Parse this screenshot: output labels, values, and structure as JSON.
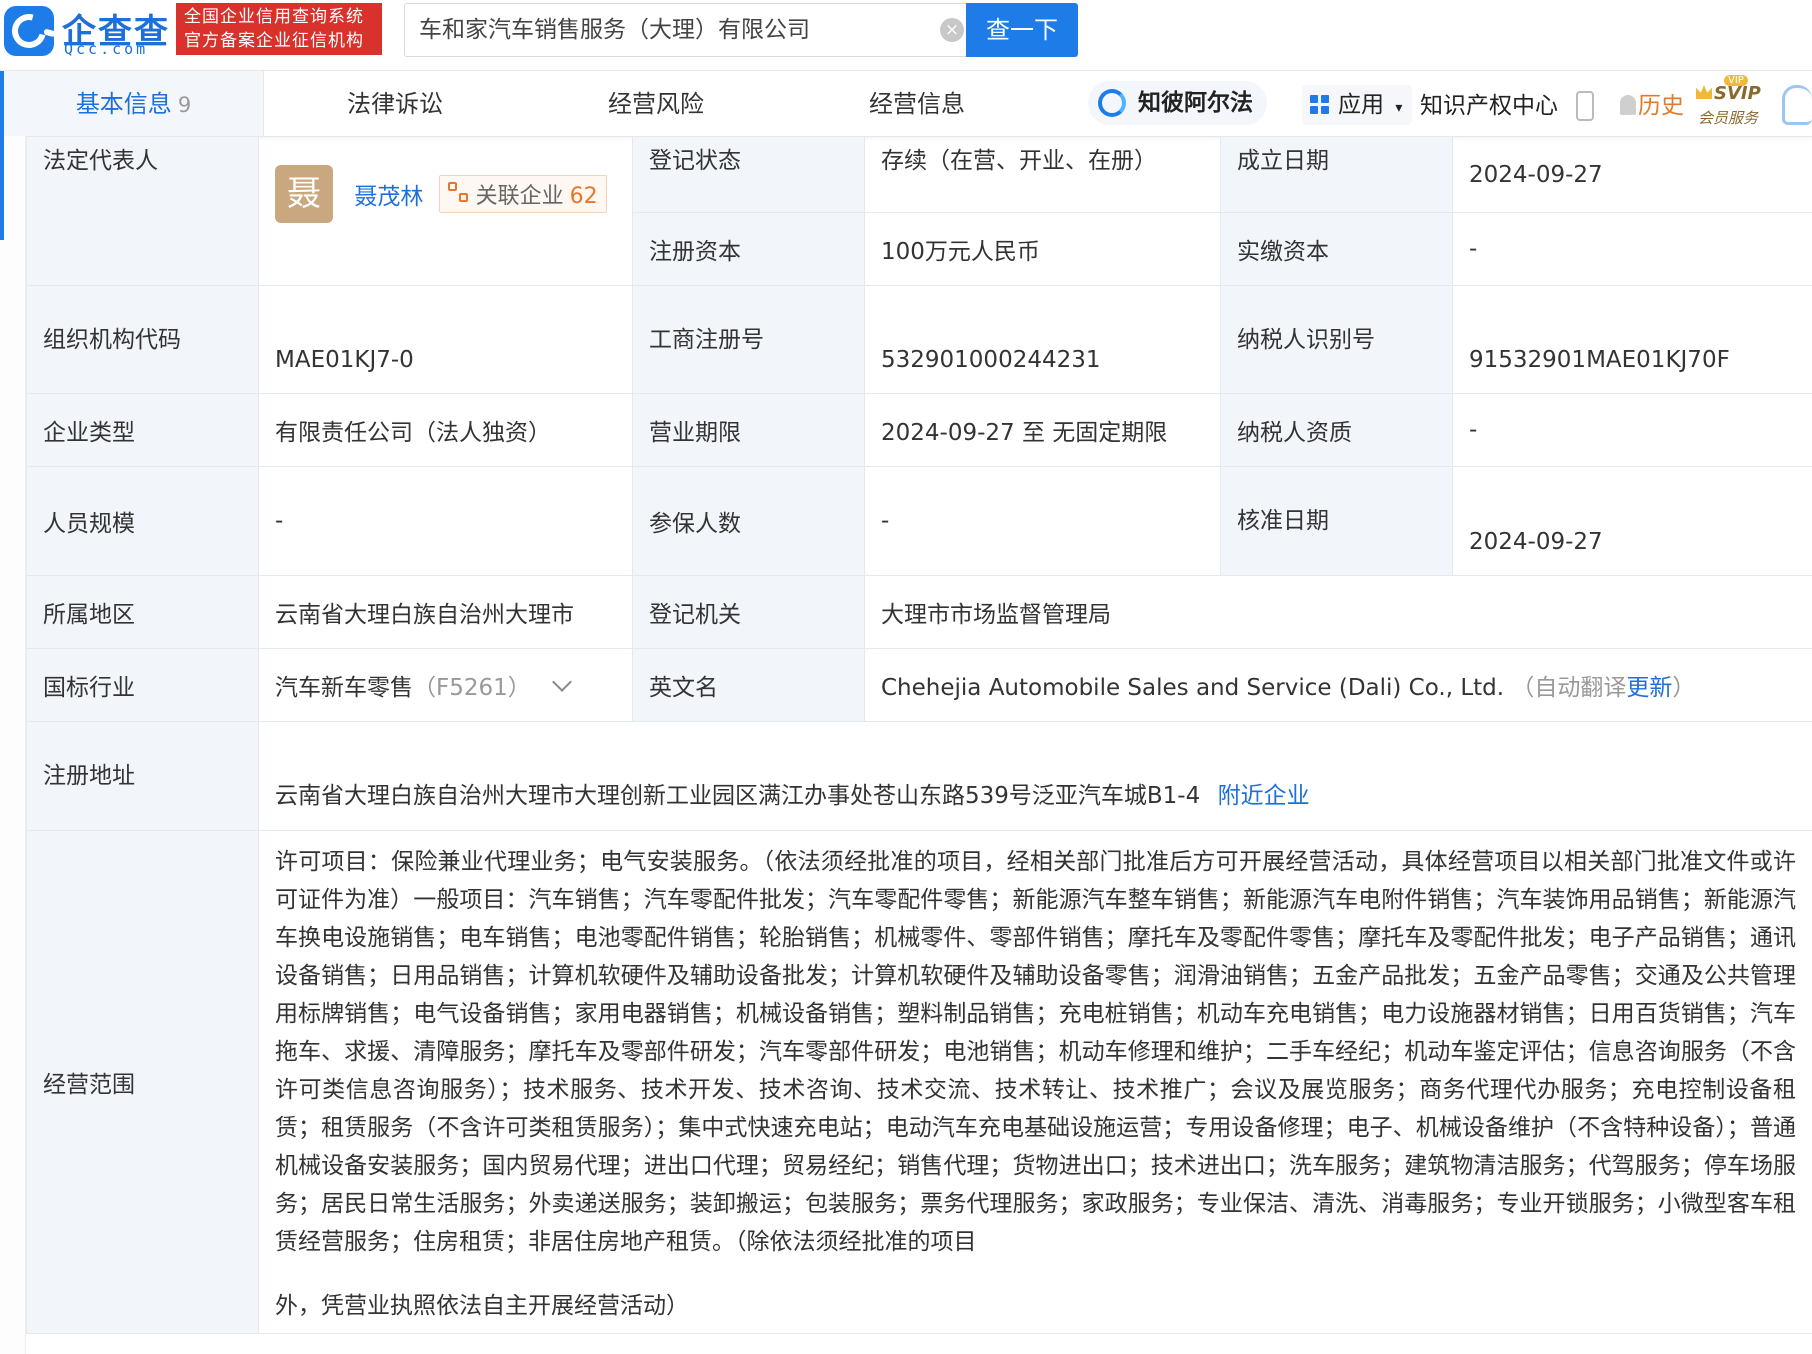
{
  "header": {
    "logo_text": "企查查",
    "logo_sub": "Qcc.com",
    "slogan_line1": "全国企业信用查询系统",
    "slogan_line2": "官方备案企业征信机构",
    "search_value": "车和家汽车销售服务（大理）有限公司",
    "search_button": "查一下"
  },
  "nav": {
    "tabs": [
      {
        "label": "基本信息",
        "count": "9"
      },
      {
        "label": "法律诉讼"
      },
      {
        "label": "经营风险"
      },
      {
        "label": "经营信息"
      }
    ],
    "zhibi": "知彼阿尔法",
    "apps": "应用",
    "zhichan": "知识产权中心",
    "history": "历史",
    "svip_l1": "SVIP",
    "svip_l2": "会员服务",
    "vip_tag": "VIP"
  },
  "info": {
    "legal_rep": {
      "label": "法定代表人",
      "avatar_char": "聂",
      "name": "聂茂林",
      "related_label": "关联企业",
      "related_count": "62"
    },
    "reg_status": {
      "label": "登记状态",
      "value": "存续（在营、开业、在册）"
    },
    "found_date": {
      "label": "成立日期",
      "value": "2024-09-27"
    },
    "reg_capital": {
      "label": "注册资本",
      "value": "100万元人民币"
    },
    "paid_capital": {
      "label": "实缴资本",
      "value": "-"
    },
    "org_code": {
      "label": "组织机构代码",
      "value": "MAE01KJ7-0"
    },
    "biz_reg_no": {
      "label": "工商注册号",
      "value": "532901000244231"
    },
    "taxpayer_id": {
      "label": "纳税人识别号",
      "value": "91532901MAE01KJ70F"
    },
    "company_type": {
      "label": "企业类型",
      "value": "有限责任公司（法人独资）"
    },
    "biz_term": {
      "label": "营业期限",
      "value": "2024-09-27 至 无固定期限"
    },
    "taxpayer_qual": {
      "label": "纳税人资质",
      "value": "-"
    },
    "staff_size": {
      "label": "人员规模",
      "value": "-"
    },
    "insured": {
      "label": "参保人数",
      "value": "-"
    },
    "approve_date": {
      "label": "核准日期",
      "value": "2024-09-27"
    },
    "region": {
      "label": "所属地区",
      "value": "云南省大理白族自治州大理市"
    },
    "reg_authority": {
      "label": "登记机关",
      "value": "大理市市场监督管理局"
    },
    "industry": {
      "label": "国标行业",
      "value": "汽车新车零售",
      "code": "（F5261）"
    },
    "english_name": {
      "label": "英文名",
      "value": "Chehejia Automobile Sales and Service (Dali) Co., Ltd.",
      "note_prefix": "（自动翻译",
      "note_link": "更新",
      "note_suffix": "）"
    },
    "reg_address": {
      "label": "注册地址",
      "value": "云南省大理白族自治州大理市大理创新工业园区满江办事处苍山东路539号泛亚汽车城B1-4",
      "nearby": "附近企业"
    },
    "scope": {
      "label": "经营范围",
      "value": "许可项目：保险兼业代理业务；电气安装服务。（依法须经批准的项目，经相关部门批准后方可开展经营活动，具体经营项目以相关部门批准文件或许可证件为准）一般项目：汽车销售；汽车零配件批发；汽车零配件零售；新能源汽车整车销售；新能源汽车电附件销售；汽车装饰用品销售；新能源汽车换电设施销售；电车销售；电池零配件销售；轮胎销售；机械零件、零部件销售；摩托车及零配件零售；摩托车及零配件批发；电子产品销售；通讯设备销售；日用品销售；计算机软硬件及辅助设备批发；计算机软硬件及辅助设备零售；润滑油销售；五金产品批发；五金产品零售；交通及公共管理用标牌销售；电气设备销售；家用电器销售；机械设备销售；塑料制品销售；充电桩销售；机动车充电销售；电力设施器材销售；日用百货销售；汽车拖车、求援、清障服务；摩托车及零部件研发；汽车零部件研发；电池销售；机动车修理和维护；二手车经纪；机动车鉴定评估；信息咨询服务（不含许可类信息咨询服务）；技术服务、技术开发、技术咨询、技术交流、技术转让、技术推广；会议及展览服务；商务代理代办服务；充电控制设备租赁；租赁服务（不含许可类租赁服务）；集中式快速充电站；电动汽车充电基础设施运营；专用设备修理；电子、机械设备维护（不含特种设备）；普通机械设备安装服务；国内贸易代理；进出口代理；贸易经纪；销售代理；货物进出口；技术进出口；洗车服务；建筑物清洁服务；代驾服务；停车场服务；居民日常生活服务；外卖递送服务；装卸搬运；包装服务；票务代理服务；家政服务；专业保洁、清洗、消毒服务；专业开锁服务；小微型客车租赁经营服务；住房租赁；非居住房地产租赁。（除依法须经批准的项目",
      "tail": "外，凭营业执照依法自主开展经营活动）"
    }
  }
}
